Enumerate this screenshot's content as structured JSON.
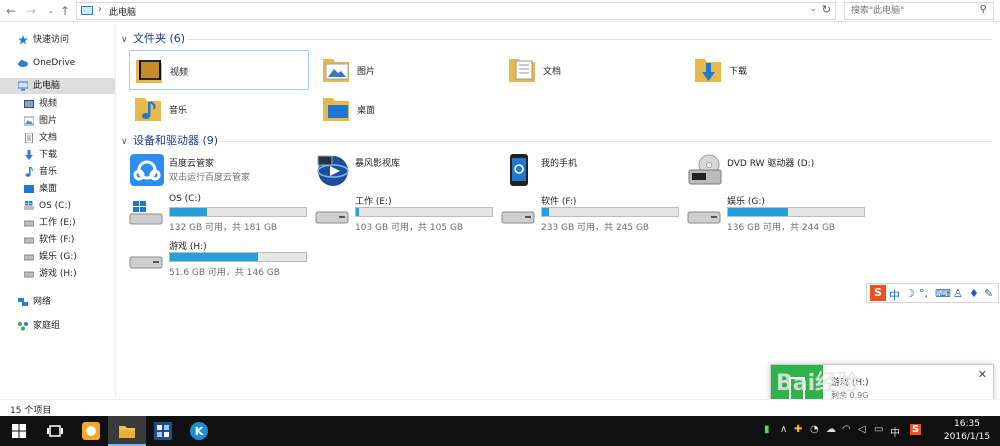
{
  "address": {
    "path": "此电脑",
    "search_placeholder": "搜索\"此电脑\""
  },
  "sidebar": {
    "quick_access": "快速访问",
    "onedrive": "OneDrive",
    "this_pc": "此电脑",
    "pc_items": [
      "视频",
      "图片",
      "文档",
      "下载",
      "音乐",
      "桌面",
      "OS (C:)",
      "工作 (E:)",
      "软件 (F:)",
      "娱乐 (G:)",
      "游戏 (H:)"
    ],
    "network": "网络",
    "homegroup": "家庭组"
  },
  "folders_group": {
    "title": "文件夹 (6)",
    "items": [
      "视频",
      "图片",
      "文档",
      "下载",
      "音乐",
      "桌面"
    ]
  },
  "devices_group": {
    "title": "设备和驱动器 (9)",
    "devices": [
      {
        "name": "百度云管家",
        "sub": "双击运行百度云管家"
      },
      {
        "name": "暴风影视库",
        "sub": ""
      },
      {
        "name": "我的手机",
        "sub": ""
      },
      {
        "name": "DVD RW 驱动器 (D:)",
        "sub": ""
      }
    ],
    "drives": [
      {
        "name": "OS (C:)",
        "free": "132 GB 可用，共 181 GB",
        "used_fraction": 0.27
      },
      {
        "name": "工作 (E:)",
        "free": "103 GB 可用，共 105 GB",
        "used_fraction": 0.02
      },
      {
        "name": "软件 (F:)",
        "free": "233 GB 可用，共 245 GB",
        "used_fraction": 0.05
      },
      {
        "name": "娱乐 (G:)",
        "free": "136 GB 可用，共 244 GB",
        "used_fraction": 0.44
      },
      {
        "name": "游戏 (H:)",
        "free": "51.6 GB 可用，共 146 GB",
        "used_fraction": 0.65
      }
    ]
  },
  "notification": {
    "title": "游戏 (H:)",
    "sub": "剩余 0.9G",
    "watermark": "Bai经验"
  },
  "status": {
    "count": "15 个项目"
  },
  "ime": {
    "mode": "中"
  },
  "taskbar": {
    "time": "16:35",
    "date": "2016/1/15",
    "ime_indicator": "中"
  },
  "colors": {
    "drive_fill": "#26a0da",
    "accent": "#1e3a8a",
    "selection_border": "#99d1ff"
  }
}
